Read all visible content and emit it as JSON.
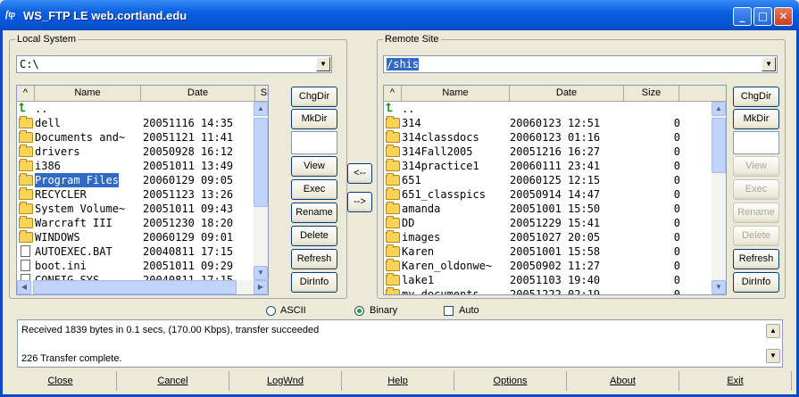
{
  "window": {
    "title": "WS_FTP LE web.cortland.edu",
    "app_icon_text": "ftp"
  },
  "local": {
    "group_label": "Local System",
    "path": "C:\\",
    "headers": {
      "sort": "^",
      "name": "Name",
      "date": "Date",
      "size": "Size"
    },
    "files": [
      {
        "icon": "up-arrow-icon",
        "name": "..",
        "date": "",
        "size": ""
      },
      {
        "icon": "folder-icon",
        "name": "dell",
        "date": "20051116 14:35",
        "size": ""
      },
      {
        "icon": "folder-icon",
        "name": "Documents and~",
        "date": "20051121 11:41",
        "size": ""
      },
      {
        "icon": "folder-icon",
        "name": "drivers",
        "date": "20050928 16:12",
        "size": ""
      },
      {
        "icon": "folder-icon",
        "name": "i386",
        "date": "20051011 13:49",
        "size": ""
      },
      {
        "icon": "folder-icon",
        "name": "Program Files",
        "date": "20060129 09:05",
        "size": "",
        "selected": true
      },
      {
        "icon": "folder-icon",
        "name": "RECYCLER",
        "date": "20051123 13:26",
        "size": ""
      },
      {
        "icon": "folder-icon",
        "name": "System Volume~",
        "date": "20051011 09:43",
        "size": ""
      },
      {
        "icon": "folder-icon",
        "name": "Warcraft III",
        "date": "20051230 18:20",
        "size": ""
      },
      {
        "icon": "folder-icon",
        "name": "WINDOWS",
        "date": "20060129 09:01",
        "size": ""
      },
      {
        "icon": "file-icon",
        "name": "AUTOEXEC.BAT",
        "date": "20040811 17:15",
        "size": ""
      },
      {
        "icon": "file-icon",
        "name": "boot.ini",
        "date": "20051011 09:29",
        "size": ""
      },
      {
        "icon": "file-icon",
        "name": "CONFIG.SYS",
        "date": "20040811 17:15",
        "size": ""
      }
    ],
    "buttons": [
      "ChgDir",
      "MkDir",
      "",
      "View",
      "Exec",
      "Rename",
      "Delete",
      "Refresh",
      "DirInfo"
    ]
  },
  "transfer": {
    "to_local": "<--",
    "to_remote": "-->"
  },
  "remote": {
    "group_label": "Remote Site",
    "path": "/shis",
    "headers": {
      "sort": "^",
      "name": "Name",
      "date": "Date",
      "size": "Size"
    },
    "files": [
      {
        "icon": "up-arrow-icon",
        "name": "..",
        "date": "",
        "size": ""
      },
      {
        "icon": "folder-icon",
        "name": "314",
        "date": "20060123 12:51",
        "size": "0"
      },
      {
        "icon": "folder-icon",
        "name": "314classdocs",
        "date": "20060123 01:16",
        "size": "0"
      },
      {
        "icon": "folder-icon",
        "name": "314Fall2005",
        "date": "20051216 16:27",
        "size": "0"
      },
      {
        "icon": "folder-icon",
        "name": "314practice1",
        "date": "20060111 23:41",
        "size": "0"
      },
      {
        "icon": "folder-icon",
        "name": "651",
        "date": "20060125 12:15",
        "size": "0"
      },
      {
        "icon": "folder-icon",
        "name": "651_classpics",
        "date": "20050914 14:47",
        "size": "0"
      },
      {
        "icon": "folder-icon",
        "name": "amanda",
        "date": "20051001 15:50",
        "size": "0"
      },
      {
        "icon": "folder-icon",
        "name": "DD",
        "date": "20051229 15:41",
        "size": "0"
      },
      {
        "icon": "folder-icon",
        "name": "images",
        "date": "20051027 20:05",
        "size": "0"
      },
      {
        "icon": "folder-icon",
        "name": "Karen",
        "date": "20051001 15:58",
        "size": "0"
      },
      {
        "icon": "folder-icon",
        "name": "Karen_oldonwe~",
        "date": "20050902 11:27",
        "size": "0"
      },
      {
        "icon": "folder-icon",
        "name": "lake1",
        "date": "20051103 19:40",
        "size": "0"
      },
      {
        "icon": "folder-icon",
        "name": "my_documents",
        "date": "20051222 02:19",
        "size": "0"
      }
    ],
    "buttons": [
      "ChgDir",
      "MkDir",
      "",
      "View",
      "Exec",
      "Rename",
      "Delete",
      "Refresh",
      "DirInfo"
    ],
    "disabled": [
      false,
      false,
      false,
      true,
      true,
      true,
      true,
      false,
      false
    ]
  },
  "mode": {
    "ascii": "ASCII",
    "binary": "Binary",
    "auto": "Auto",
    "selected": "Binary"
  },
  "log": {
    "line1": "Received 1839 bytes in 0.1 secs, (170.00 Kbps), transfer succeeded",
    "line2": "226 Transfer complete."
  },
  "bottom_buttons": [
    "Close",
    "Cancel",
    "LogWnd",
    "Help",
    "Options",
    "About",
    "Exit"
  ],
  "colors": {
    "selection": "#316ac5",
    "title_bar": "#0a5fe0",
    "folder": "#f7d358"
  }
}
